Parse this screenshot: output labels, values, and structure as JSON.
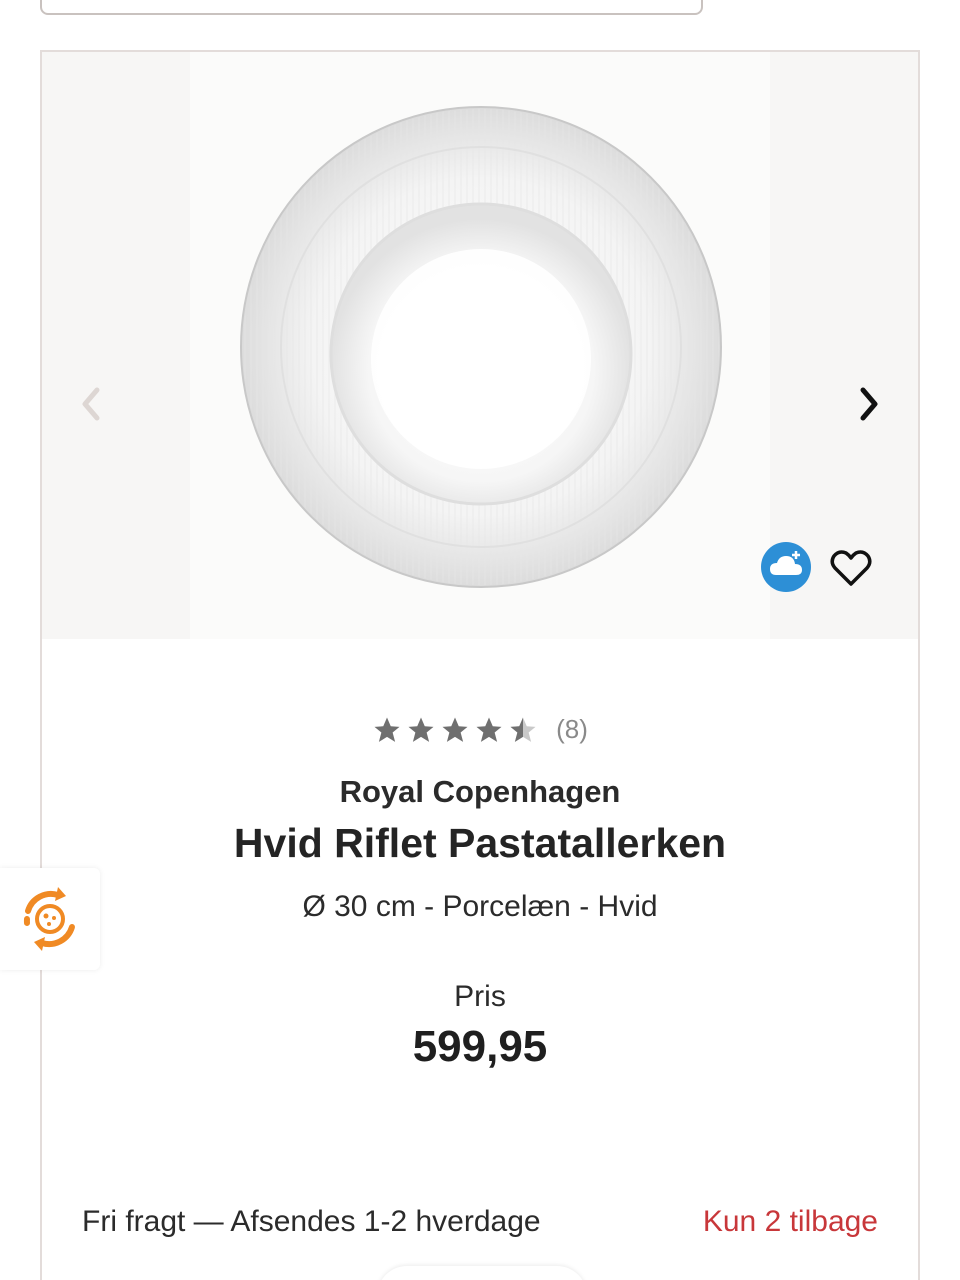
{
  "product": {
    "rating_value": 4.5,
    "rating_max": 5,
    "review_count": "(8)",
    "brand": "Royal Copenhagen",
    "title": "Hvid Riflet Pastatallerken",
    "specs": "Ø 30 cm - Porcelæn - Hvid",
    "price_label": "Pris",
    "price": "599,95",
    "shipping": "Fri fragt — Afsendes 1-2 hverdage",
    "stock": "Kun 2 tilbage"
  },
  "gallery": {
    "image_alt": "Hvid Riflet Pastatallerken",
    "prev_icon": "chevron-left-icon",
    "next_icon": "chevron-right-icon"
  },
  "actions": {
    "cloud_icon": "cloud-add-icon",
    "wishlist_icon": "heart-icon"
  },
  "side_widget": {
    "icon": "cookie-settings-icon"
  },
  "colors": {
    "accent_red": "#c8373a",
    "cloud_blue": "#2d8fd6",
    "widget_orange": "#f08a24"
  }
}
